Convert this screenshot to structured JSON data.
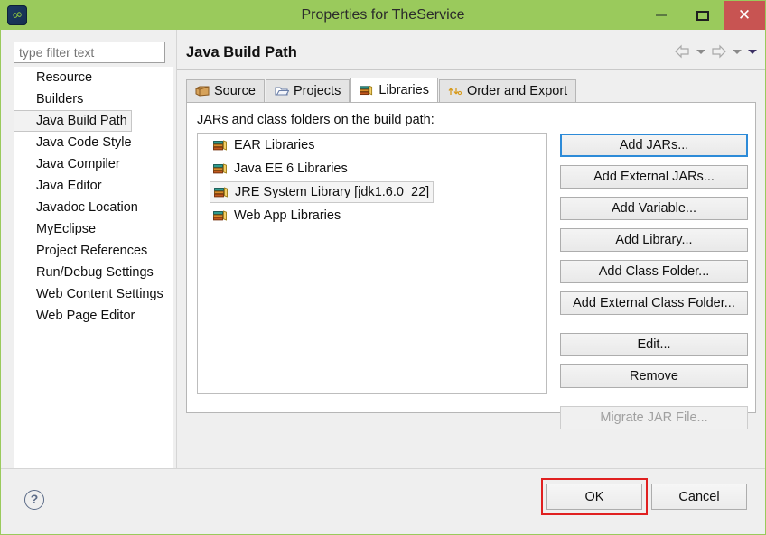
{
  "window": {
    "title": "Properties for TheService",
    "app_icon": "myeclipse-icon",
    "accent_green": "#9ACA5C",
    "close_red": "#C85452",
    "controls": [
      {
        "name": "minimize-button",
        "glyph": "minimize-icon"
      },
      {
        "name": "maximize-button",
        "glyph": "maximize-icon"
      },
      {
        "name": "close-button",
        "glyph": "close-icon"
      }
    ]
  },
  "filter": {
    "placeholder": "type filter text",
    "value": ""
  },
  "tree": {
    "items": [
      {
        "label": "Resource",
        "selected": false
      },
      {
        "label": "Builders",
        "selected": false
      },
      {
        "label": "Java Build Path",
        "selected": true
      },
      {
        "label": "Java Code Style",
        "selected": false
      },
      {
        "label": "Java Compiler",
        "selected": false
      },
      {
        "label": "Java Editor",
        "selected": false
      },
      {
        "label": "Javadoc Location",
        "selected": false
      },
      {
        "label": "MyEclipse",
        "selected": false
      },
      {
        "label": "Project References",
        "selected": false
      },
      {
        "label": "Run/Debug Settings",
        "selected": false
      },
      {
        "label": "Web Content Settings",
        "selected": false
      },
      {
        "label": "Web Page Editor",
        "selected": false
      }
    ],
    "scrollbar": {
      "left_arrow": "chevron-left-icon",
      "right_arrow": "chevron-right-icon"
    }
  },
  "page": {
    "title": "Java Build Path",
    "nav": [
      {
        "name": "back-arrow-icon",
        "label": "Back"
      },
      {
        "name": "back-dropdown-icon",
        "label": "Back history"
      },
      {
        "name": "forward-arrow-icon",
        "label": "Forward"
      },
      {
        "name": "forward-dropdown-icon",
        "label": "Forward history"
      },
      {
        "name": "view-menu-icon",
        "label": "View menu"
      }
    ]
  },
  "tabs": [
    {
      "label": "Source",
      "icon": "package-icon",
      "active": false
    },
    {
      "label": "Projects",
      "icon": "folder-icon",
      "active": false
    },
    {
      "label": "Libraries",
      "icon": "books-icon",
      "active": true
    },
    {
      "label": "Order and Export",
      "icon": "order-arrows-icon",
      "active": false
    }
  ],
  "libraries_tab": {
    "list_label": "JARs and class folders on the build path:",
    "entries": [
      {
        "label": "EAR Libraries",
        "icon": "books-icon",
        "selected": false
      },
      {
        "label": "Java EE 6 Libraries",
        "icon": "books-icon",
        "selected": false
      },
      {
        "label": "JRE System Library [jdk1.6.0_22]",
        "icon": "books-icon",
        "selected": true
      },
      {
        "label": "Web App Libraries",
        "icon": "books-icon",
        "selected": false
      }
    ],
    "buttons": [
      {
        "label": "Add JARs...",
        "state": "focused"
      },
      {
        "label": "Add External JARs...",
        "state": "normal"
      },
      {
        "label": "Add Variable...",
        "state": "normal"
      },
      {
        "label": "Add Library...",
        "state": "normal"
      },
      {
        "label": "Add Class Folder...",
        "state": "normal"
      },
      {
        "label": "Add External Class Folder...",
        "state": "normal"
      },
      {
        "label": "Edit...",
        "state": "normal"
      },
      {
        "label": "Remove",
        "state": "normal"
      },
      {
        "label": "Migrate JAR File...",
        "state": "disabled"
      }
    ]
  },
  "footer": {
    "help_icon": "help-icon",
    "help_label": "?",
    "ok_label": "OK",
    "cancel_label": "Cancel",
    "highlight_color": "#E02020",
    "highlighted_button": "OK"
  }
}
